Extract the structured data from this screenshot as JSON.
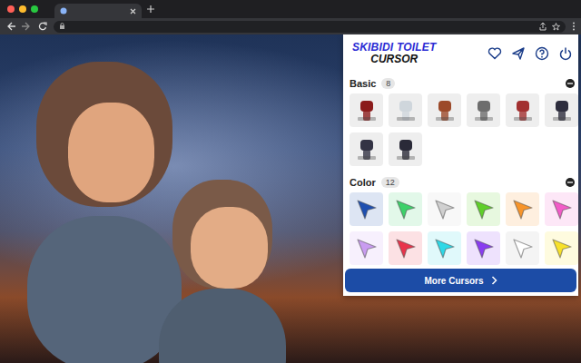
{
  "panel": {
    "logo": {
      "line1": "SKIBIDI TOILET",
      "line2": "CURSOR"
    },
    "sections": [
      {
        "title": "Basic",
        "count": "8",
        "expanded": true,
        "items": [
          {
            "color": "#8b1c1c"
          },
          {
            "color": "#cfd6dc"
          },
          {
            "color": "#9c4a2a"
          },
          {
            "color": "#6d6d6d"
          },
          {
            "color": "#a23030"
          },
          {
            "color": "#2d2d3d"
          },
          {
            "color": "#333344"
          },
          {
            "color": "#2a2a38"
          }
        ]
      },
      {
        "title": "Color",
        "count": "12",
        "expanded": true,
        "items": [
          {
            "color": "#1e4fb0"
          },
          {
            "color": "#3dd16a"
          },
          {
            "color": "#d0d0d0"
          },
          {
            "color": "#5fcf2a"
          },
          {
            "color": "#f7942a"
          },
          {
            "color": "#f25bc8"
          },
          {
            "color": "#c99cf0"
          },
          {
            "color": "#e8344c"
          },
          {
            "color": "#2ed8e6"
          },
          {
            "color": "#8a3df0"
          },
          {
            "color": "#ffffff"
          },
          {
            "color": "#f7e12a"
          }
        ]
      }
    ],
    "more_button": {
      "label": "More Cursors"
    }
  }
}
